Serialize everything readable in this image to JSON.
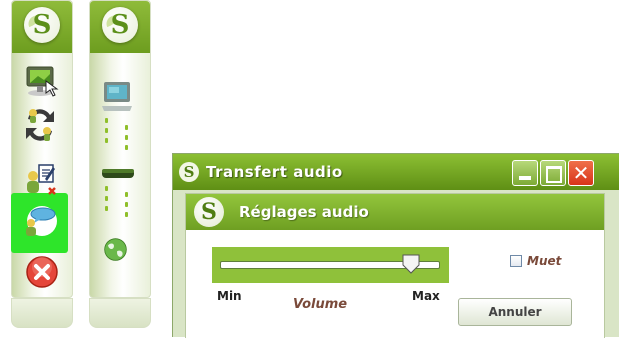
{
  "toolbar1": {
    "items": [
      {
        "icon": "monitor-hand-icon",
        "selected": false
      },
      {
        "icon": "users-exchange-icon",
        "selected": false
      },
      {
        "icon": "user-edit-icon",
        "selected": false
      },
      {
        "icon": "user-chat-icon",
        "selected": true
      },
      {
        "icon": "close-icon",
        "selected": false
      }
    ],
    "selection_color": "#2ee52a"
  },
  "toolbar2": {
    "items": [
      {
        "icon": "computer-icon"
      },
      {
        "icon": "network-bar-icon"
      },
      {
        "icon": "globe-icon"
      }
    ]
  },
  "dialog": {
    "title": "Transfert audio",
    "panel_title": "Réglages audio",
    "slider": {
      "label": "Volume",
      "min_label": "Min",
      "max_label": "Max",
      "value": 0.87
    },
    "mute": {
      "label": "Muet",
      "checked": false
    },
    "cancel_label": "Annuler"
  },
  "colors": {
    "accent_green": "#7cb32a",
    "close_red": "#d7341a",
    "label_brown": "#7a4a3a"
  }
}
